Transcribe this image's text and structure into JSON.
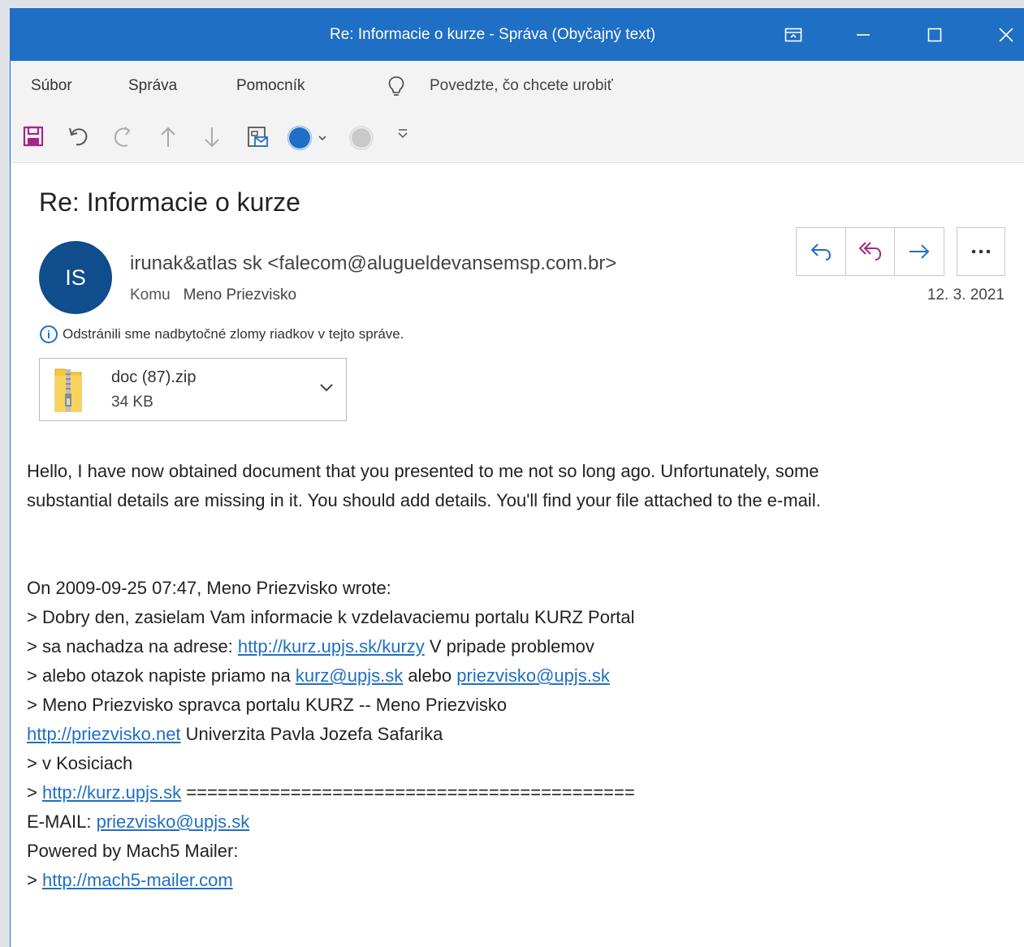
{
  "window": {
    "title": "Re: Informacie o kurze  -  Správa (Obyčajný text)"
  },
  "menu": {
    "items": [
      "Súbor",
      "Správa",
      "Pomocník"
    ],
    "tell_me": "Povedzte, čo chcete urobiť"
  },
  "message": {
    "subject": "Re: Informacie o kurze",
    "avatar_initials": "IS",
    "sender": "irunak&atlas sk <falecom@alugueldevansemsp.com.br>",
    "to_label": "Komu",
    "to_value": "Meno Priezvisko",
    "date": "12. 3. 2021",
    "info_notice": "Odstránili sme nadbytočné zlomy riadkov v tejto správe.",
    "attachment": {
      "name": "doc (87).zip",
      "size": "34 KB"
    }
  },
  "body": {
    "para1_line1": "Hello, I have now obtained document that you presented to me not so long ago. Unfortunately, some",
    "para1_line2": "substantial details are missing in it. You should add details. You'll find your file attached to the e-mail.",
    "q_line1": "On 2009-09-25 07:47, Meno Priezvisko wrote:",
    "q_line2": "> Dobry den, zasielam Vam informacie k vzdelavaciemu portalu KURZ Portal",
    "q_line3_prefix": "> sa nachadza na adrese: ",
    "q_line3_link": "http://kurz.upjs.sk/kurzy",
    "q_line3_suffix": "  V pripade problemov",
    "q_line4_prefix": "> alebo otazok napiste priamo na ",
    "q_line4_link1": "kurz@upjs.sk",
    "q_line4_mid": " alebo ",
    "q_line4_link2": "priezvisko@upjs.sk",
    "q_line5": "> Meno Priezvisko spravca portalu KURZ -- Meno Priezvisko",
    "q_line6_link": "http://priezvisko.net",
    "q_line6_suffix": " Univerzita Pavla Jozefa Safarika",
    "q_line7": "> v Kosiciach",
    "q_line8_prefix": "> ",
    "q_line8_link": "http://kurz.upjs.sk",
    "q_line8_suffix": " ===========================================",
    "q_line9_prefix": "E-MAIL: ",
    "q_line9_link": "priezvisko@upjs.sk",
    "q_line10": "Powered by Mach5 Mailer:",
    "q_line11_prefix": "> ",
    "q_line11_link": "http://mach5-mailer.com"
  }
}
